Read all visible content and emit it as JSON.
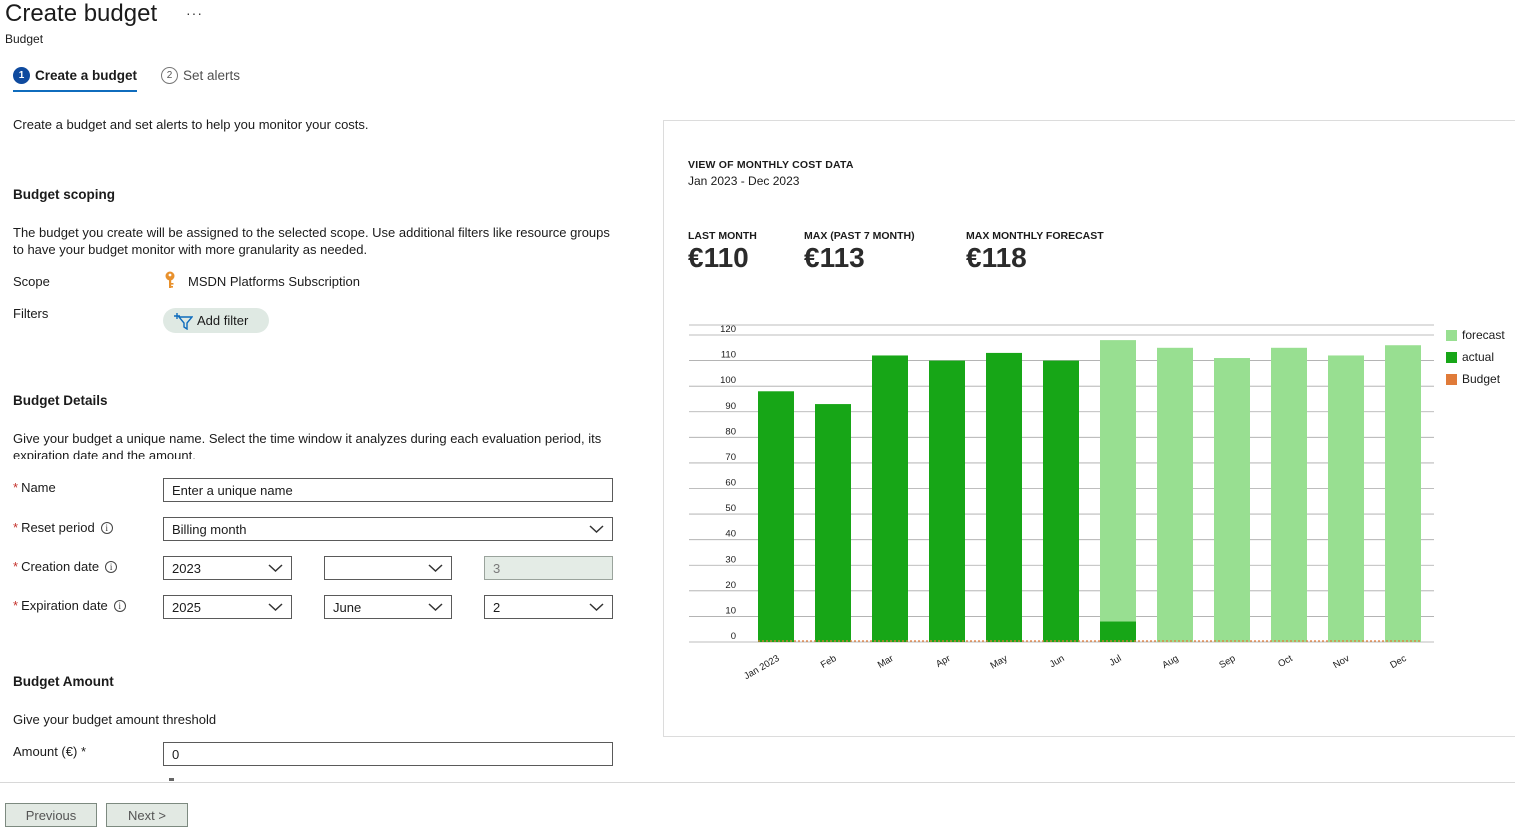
{
  "header": {
    "title": "Create budget",
    "more": "···",
    "subtitle": "Budget"
  },
  "steps": [
    {
      "number": "1",
      "label": "Create a budget",
      "active": true
    },
    {
      "number": "2",
      "label": "Set alerts",
      "active": false
    }
  ],
  "intro": "Create a budget and set alerts to help you monitor your costs.",
  "scoping": {
    "heading": "Budget scoping",
    "description": "The budget you create will be assigned to the selected scope. Use additional filters like resource groups to have your budget monitor with more granularity as needed.",
    "scope_label": "Scope",
    "scope_value": "MSDN Platforms Subscription",
    "filters_label": "Filters",
    "add_filter": "Add filter"
  },
  "details": {
    "heading": "Budget Details",
    "description": "Give your budget a unique name. Select the time window it analyzes during each evaluation period, its expiration date and the amount.",
    "name_label": "Name",
    "name_placeholder": "Enter a unique name",
    "reset_label": "Reset period",
    "reset_value": "Billing month",
    "creation_label": "Creation date",
    "creation_year": "2023",
    "creation_month": "",
    "creation_day": "3",
    "expiration_label": "Expiration date",
    "expiration_year": "2025",
    "expiration_month": "June",
    "expiration_day": "2"
  },
  "amount": {
    "heading": "Budget Amount",
    "description": "Give your budget amount threshold",
    "label": "Amount (€)",
    "required": "*",
    "value": "0"
  },
  "footer": {
    "previous": "Previous",
    "next": "Next >"
  },
  "panel": {
    "title": "VIEW OF MONTHLY COST DATA",
    "range": "Jan 2023 - Dec 2023",
    "kpis": [
      {
        "label": "LAST MONTH",
        "value": "€110"
      },
      {
        "label": "MAX (PAST 7 MONTH)",
        "value": "€113"
      },
      {
        "label": "MAX MONTHLY FORECAST",
        "value": "€118"
      }
    ]
  },
  "colors": {
    "actual": "#17a617",
    "forecast": "#98df91",
    "budget": "#e07b39",
    "accent": "#0f6cbd"
  },
  "chart_data": {
    "type": "bar",
    "categories": [
      "Jan 2023",
      "Feb",
      "Mar",
      "Apr",
      "May",
      "Jun",
      "Jul",
      "Aug",
      "Sep",
      "Oct",
      "Nov",
      "Dec"
    ],
    "series": [
      {
        "name": "forecast",
        "values": [
          0,
          0,
          0,
          0,
          0,
          0,
          118,
          115,
          111,
          115,
          112,
          116
        ]
      },
      {
        "name": "actual",
        "values": [
          98,
          93,
          112,
          110,
          113,
          110,
          8,
          0,
          0,
          0,
          0,
          0
        ]
      },
      {
        "name": "Budget",
        "values": [
          0,
          0,
          0,
          0,
          0,
          0,
          0,
          0,
          0,
          0,
          0,
          0
        ]
      }
    ],
    "y_ticks": [
      "0",
      "10",
      "20",
      "30",
      "40",
      "50",
      "60",
      "70",
      "80",
      "90",
      "100",
      "110",
      "120"
    ],
    "ylim": [
      0,
      120
    ],
    "grid": true,
    "legend": "right"
  }
}
